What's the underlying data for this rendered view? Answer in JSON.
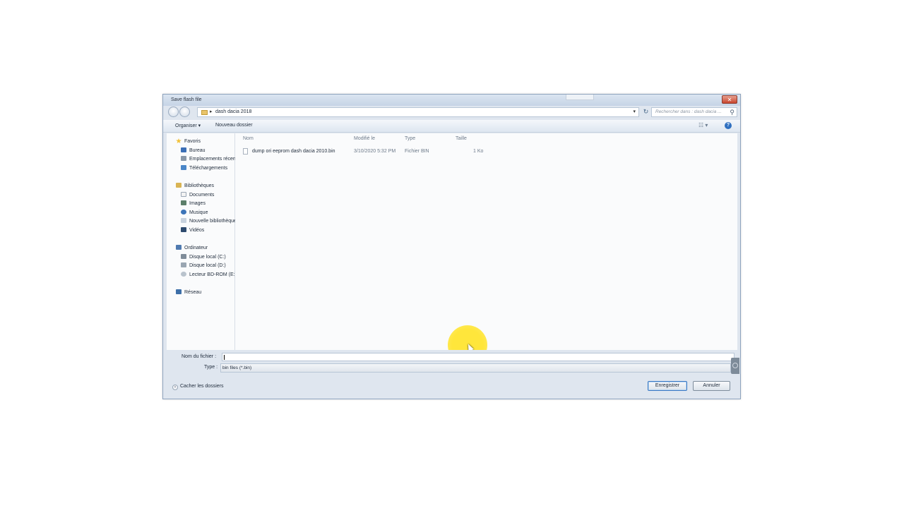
{
  "window": {
    "title": "Save flash file",
    "close_glyph": "✕"
  },
  "address": {
    "separator": "▸",
    "path": "dash dacia 2018",
    "dropdown_glyph": "▾",
    "refresh_glyph": "↻",
    "search_placeholder": "Rechercher dans : dash dacia ...",
    "search_glyph": "⚲"
  },
  "toolbar": {
    "organize": "Organiser ▾",
    "new_folder": "Nouveau dossier",
    "view_glyph": "☷ ▾",
    "help_glyph": "?"
  },
  "nav": {
    "favorites": "Favoris",
    "bureau": "Bureau",
    "recent": "Emplacements récents",
    "downloads": "Téléchargements",
    "libraries": "Bibliothèques",
    "documents": "Documents",
    "images": "Images",
    "music": "Musique",
    "new_library": "Nouvelle bibliothèque",
    "videos": "Vidéos",
    "computer": "Ordinateur",
    "disk_c": "Disque local (C:)",
    "disk_d": "Disque local (D:)",
    "bdrom": "Lecteur BD-ROM (E:)",
    "network": "Réseau"
  },
  "columns": {
    "name": "Nom",
    "modified": "Modifié le",
    "type": "Type",
    "size": "Taille"
  },
  "files": [
    {
      "name": "dump ori eeprom dash dacia 2010.bin",
      "modified": "3/10/2020 5:32 PM",
      "type": "Fichier BIN",
      "size": "1 Ko"
    }
  ],
  "form": {
    "filename_label": "Nom du fichier :",
    "filename_value": "",
    "type_label": "Type :",
    "type_value": "bin files (*.bin)",
    "hide_folders": "Cacher les dossiers",
    "hide_glyph": "˄"
  },
  "buttons": {
    "save": "Enregistrer",
    "cancel": "Annuler"
  },
  "colors": {
    "highlight": "#ffe63b",
    "dialog_bg": "#dfe6ef",
    "close_red": "#c8452e"
  }
}
